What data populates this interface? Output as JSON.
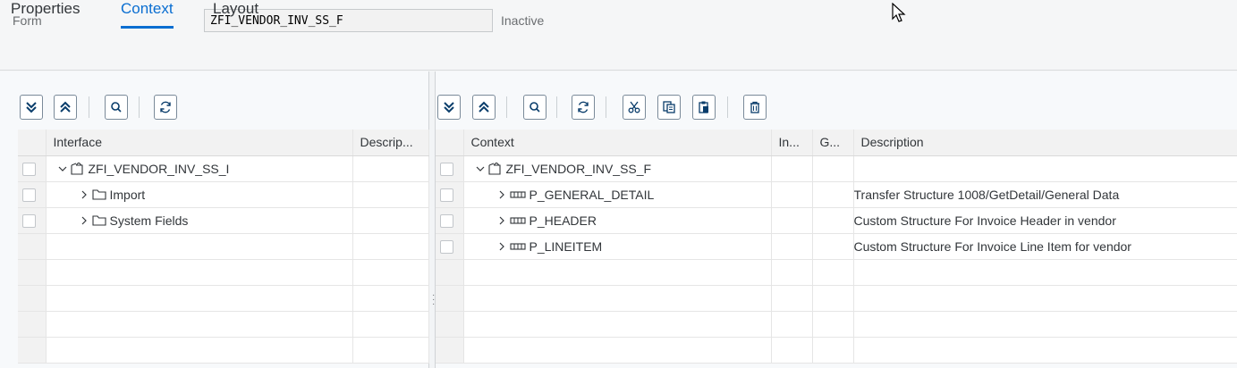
{
  "header": {
    "form_label": "Form",
    "form_value": "ZFI_VENDOR_INV_SS_F",
    "status": "Inactive"
  },
  "tabs": [
    {
      "label": "Properties",
      "active": false
    },
    {
      "label": "Context",
      "active": true
    },
    {
      "label": "Layout",
      "active": false
    }
  ],
  "accent_color": "#0a6ed1",
  "left_panel": {
    "toolbar": [
      "expand-all-icon",
      "collapse-all-icon",
      "search-icon",
      "refresh-icon"
    ],
    "columns": [
      "Interface",
      "Descrip..."
    ],
    "rows": [
      {
        "name": "ZFI_VENDOR_INV_SS_I",
        "icon": "interface-icon",
        "expanded": true,
        "description": ""
      },
      {
        "name": "Import",
        "icon": "folder-icon",
        "expanded": false,
        "description": ""
      },
      {
        "name": "System Fields",
        "icon": "folder-icon",
        "expanded": false,
        "description": ""
      }
    ]
  },
  "right_panel": {
    "toolbar": [
      "expand-all-icon",
      "collapse-all-icon",
      "search-icon",
      "refresh-icon",
      "cut-icon",
      "copy-icon",
      "paste-icon",
      "delete-icon"
    ],
    "columns": [
      "Context",
      "In...",
      "G...",
      "Description"
    ],
    "rows": [
      {
        "name": "ZFI_VENDOR_INV_SS_F",
        "icon": "interface-icon",
        "expanded": true,
        "description": ""
      },
      {
        "name": "P_GENERAL_DETAIL",
        "icon": "structure-icon",
        "expanded": false,
        "description": "Transfer Structure 1008/GetDetail/General Data"
      },
      {
        "name": "P_HEADER",
        "icon": "structure-icon",
        "expanded": false,
        "description": "Custom Structure For Invoice Header in vendor"
      },
      {
        "name": "P_LINEITEM",
        "icon": "structure-icon",
        "expanded": false,
        "description": "Custom Structure For Invoice Line Item for vendor"
      }
    ]
  }
}
